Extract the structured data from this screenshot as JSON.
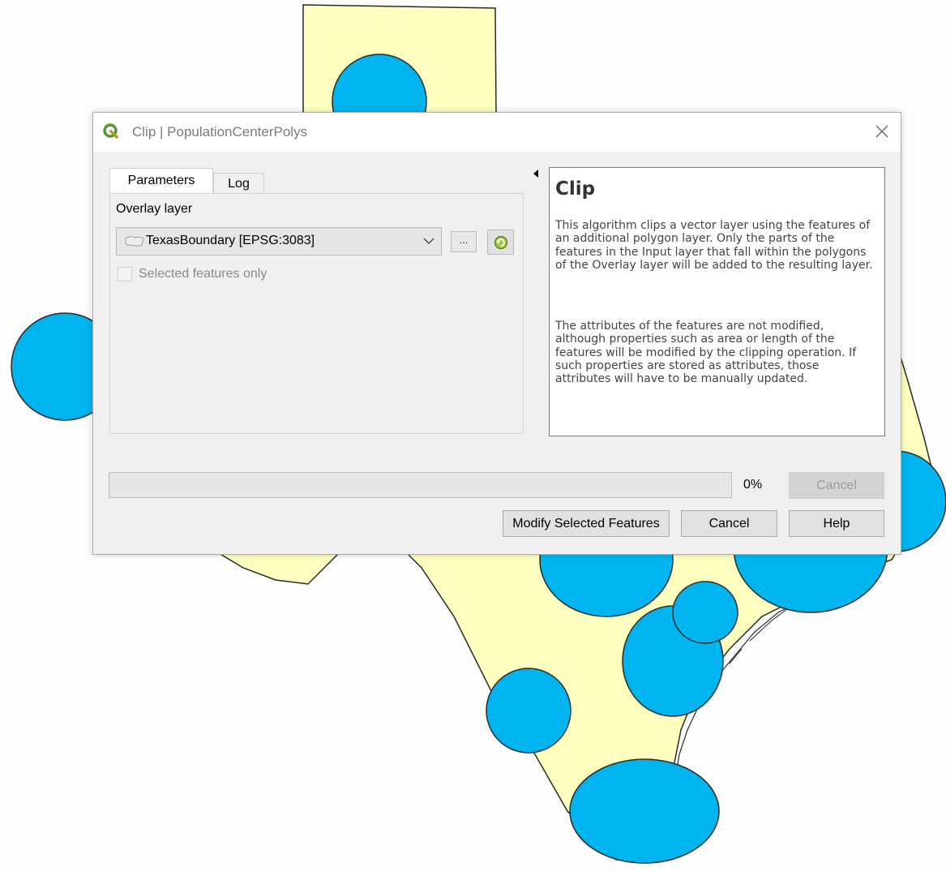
{
  "dialog": {
    "title": "Clip | PopulationCenterPolys",
    "close_icon": "close-icon",
    "app_icon": "qgis-logo-icon"
  },
  "tabs": [
    {
      "label": "Parameters",
      "active": true
    },
    {
      "label": "Log",
      "active": false
    }
  ],
  "parameters": {
    "overlay_label": "Overlay layer",
    "overlay_value": "TexasBoundary [EPSG:3083]",
    "overlay_icon": "polygon-layer-icon",
    "ellipsis_label": "...",
    "iterate_icon": "iterate-icon",
    "selected_only_label": "Selected features only",
    "selected_only_checked": false
  },
  "help": {
    "title": "Clip",
    "paragraph1": "This algorithm clips a vector layer using the features of an additional polygon layer. Only the parts of the features in the Input layer that fall within the polygons of the Overlay layer will be added to the resulting layer.",
    "paragraph2": "The attributes of the features are not modified, although properties such as area or length of the features will be modified by the clipping operation. If such properties are stored as attributes, those attributes will have to be manually updated."
  },
  "progress": {
    "value": 0,
    "label": "0%"
  },
  "buttons": {
    "cancel_disabled": "Cancel",
    "modify": "Modify Selected Features",
    "cancel": "Cancel",
    "help": "Help"
  },
  "colors": {
    "land_fill": "#ffffc0",
    "circle_fill": "#00b4ef",
    "outline": "#2a2a2a",
    "map_background": "#fdfdfd"
  }
}
